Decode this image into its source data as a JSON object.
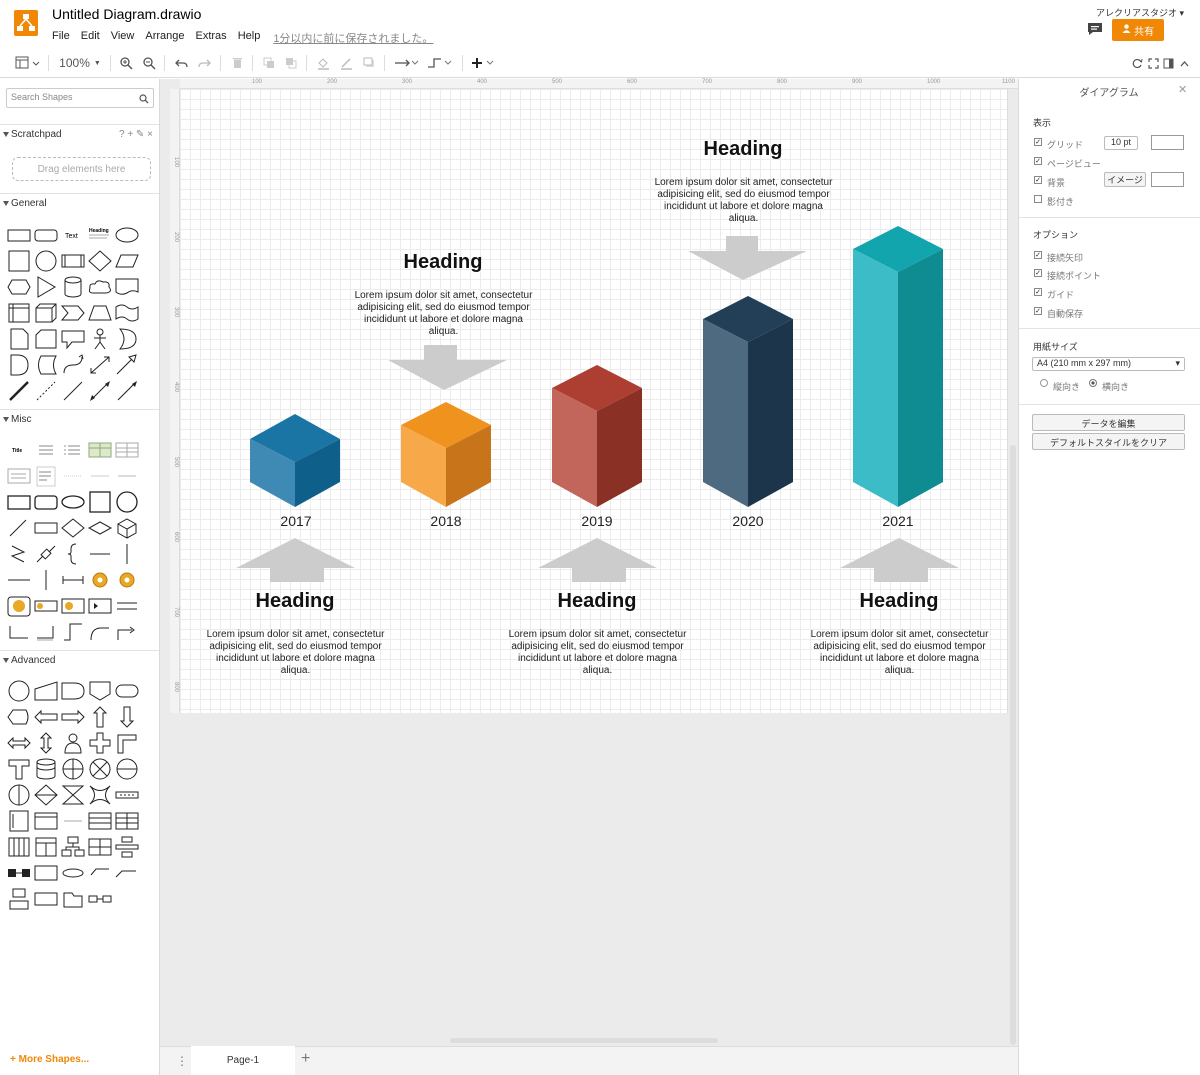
{
  "app": {
    "title": "Untitled Diagram.drawio",
    "menu": [
      "File",
      "Edit",
      "View",
      "Arrange",
      "Extras",
      "Help"
    ],
    "saved_status": "1分以内に前に保存されました。",
    "user": "アレクリアスタジオ ▾",
    "share_label": "共有"
  },
  "toolbar": {
    "zoom": "100%"
  },
  "left_panel": {
    "search_placeholder": "Search Shapes",
    "scratchpad": "Scratchpad",
    "scratchpad_tools": "? + ✎ ×",
    "drag_hint": "Drag elements here",
    "sections": [
      "General",
      "Misc",
      "Advanced"
    ],
    "general_text": "Text",
    "general_heading": "Heading",
    "misc_title": "Title",
    "more_shapes": "More Shapes..."
  },
  "ruler": {
    "top": [
      "100",
      "200",
      "300",
      "400",
      "500",
      "600",
      "700",
      "800",
      "900",
      "1000",
      "1100"
    ],
    "left": [
      "100",
      "200",
      "300",
      "400",
      "500",
      "600",
      "700",
      "800"
    ]
  },
  "diagram": {
    "bars": [
      {
        "year": "2017",
        "front": "#3e8ab5",
        "side": "#0e5f8a",
        "top": "#1a74a4"
      },
      {
        "year": "2018",
        "front": "#f7a94a",
        "side": "#c8741a",
        "top": "#f0921e"
      },
      {
        "year": "2019",
        "front": "#c2655b",
        "side": "#8a3025",
        "top": "#ac3f31"
      },
      {
        "year": "2020",
        "front": "#4e6a80",
        "side": "#1c354a",
        "top": "#233f57"
      },
      {
        "year": "2021",
        "front": "#3bbcc6",
        "side": "#0e8c91",
        "top": "#12a5ae"
      }
    ],
    "heading": "Heading",
    "lorem_lines": [
      "Lorem ipsum dolor sit amet, consectetur",
      "adipisicing elit, sed do eiusmod tempor",
      "incididunt ut labore et dolore magna",
      "aliqua."
    ],
    "arrow_color": "#cccccc"
  },
  "page_tab": "Page-1",
  "right_panel": {
    "title": "ダイアグラム",
    "display_section": "表示",
    "grid": "グリッド",
    "grid_size": "10 pt",
    "page_view": "ページビュー",
    "background": "背景",
    "image_btn": "イメージ",
    "shadow": "影付き",
    "options_section": "オプション",
    "connection_arrows": "接続矢印",
    "connection_points": "接続ポイント",
    "guides": "ガイド",
    "autosave": "自動保存",
    "paper_size_section": "用紙サイズ",
    "paper_size": "A4 (210 mm x 297 mm)",
    "portrait": "縦向き",
    "landscape": "横向き",
    "edit_data": "データを編集",
    "clear_style": "デフォルトスタイルをクリア"
  }
}
